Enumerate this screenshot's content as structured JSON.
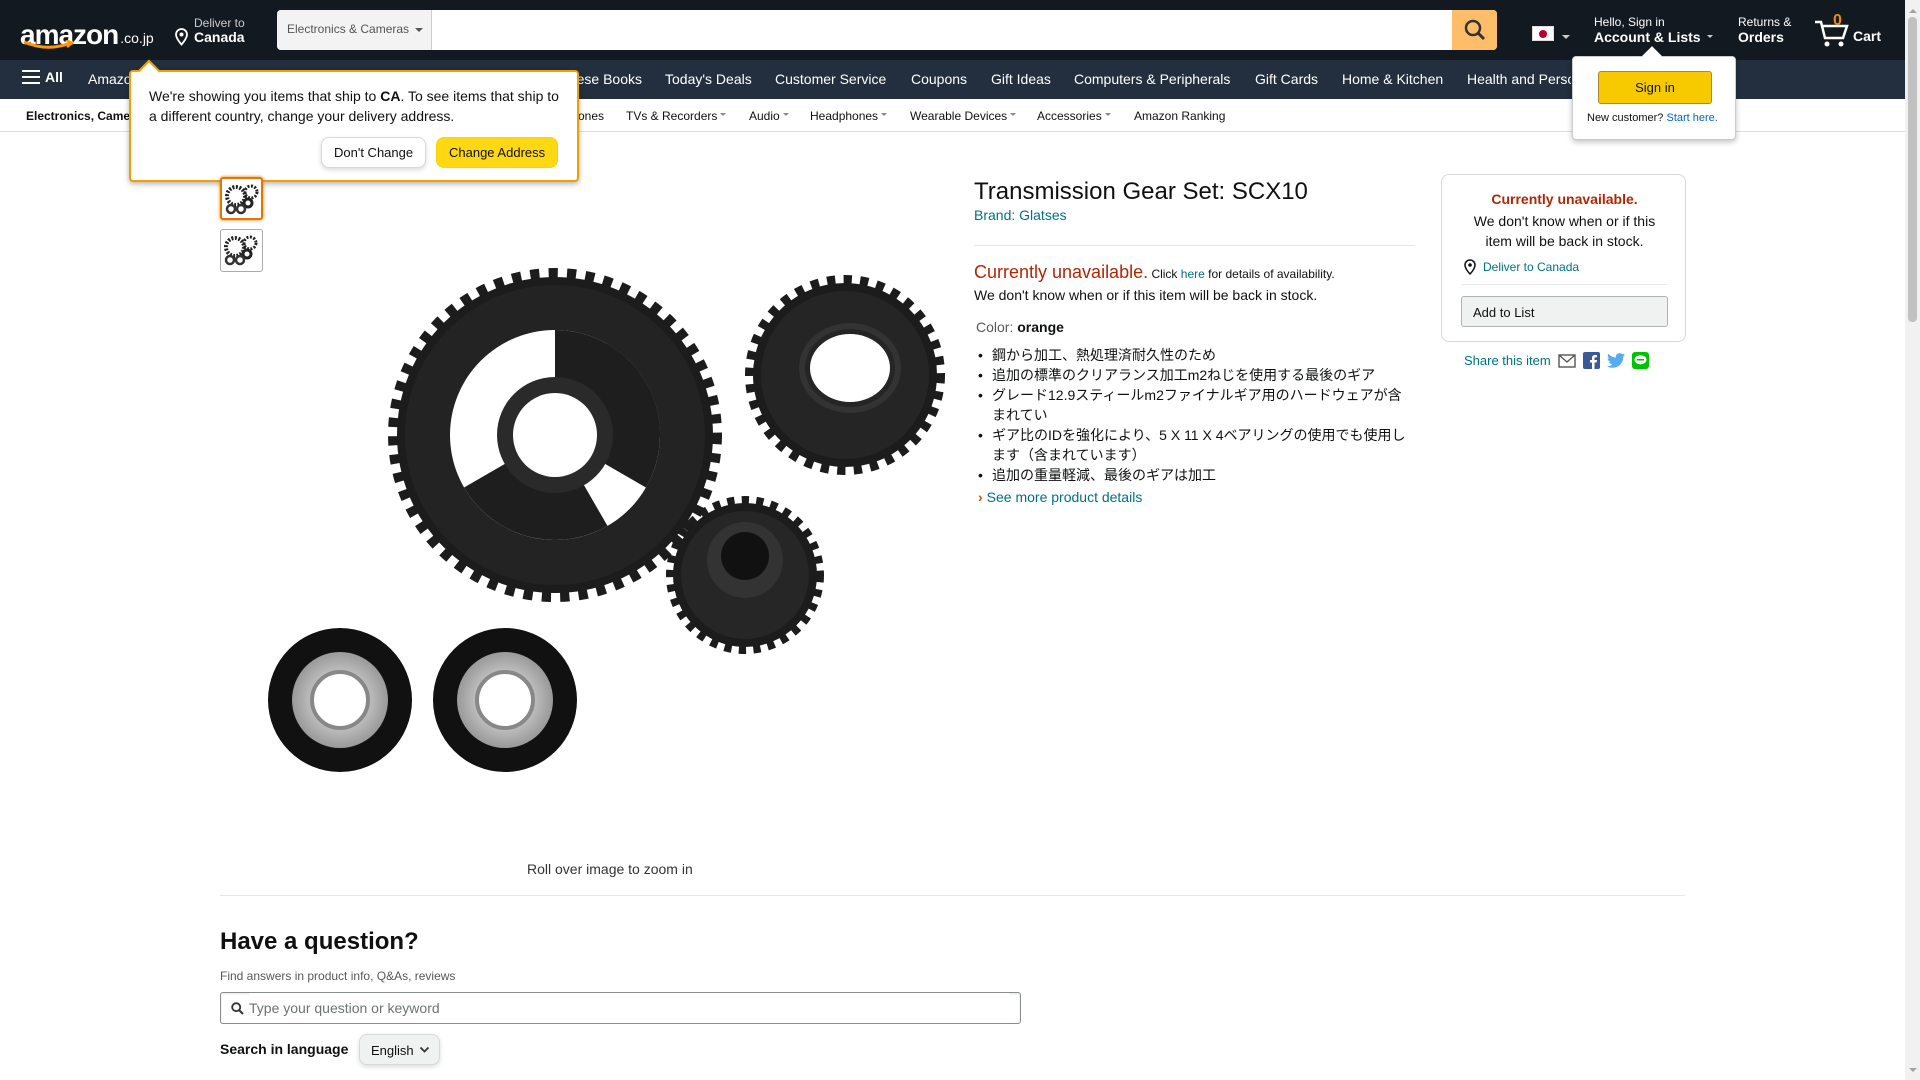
{
  "header": {
    "logo_word": "amazon",
    "logo_tld": ".co.jp",
    "deliver_line1": "Deliver to",
    "deliver_line2": "Canada",
    "search_category": "Electronics & Cameras",
    "search_value": "",
    "account_line1": "Hello, Sign in",
    "account_line2": "Account & Lists",
    "returns_line1": "Returns &",
    "returns_line2": "Orders",
    "cart_count": "0",
    "cart_label": "Cart"
  },
  "nav": {
    "all_label": "All",
    "items": [
      "Amazon",
      "Chinese Books",
      "Today's Deals",
      "Customer Service",
      "Coupons",
      "Gift Ideas",
      "Computers & Peripherals",
      "Gift Cards",
      "Home & Kitchen",
      "Health and Personal Care"
    ]
  },
  "subnav": {
    "items": [
      "Electronics, Cameras",
      "Phones",
      "TVs & Recorders",
      "Audio",
      "Headphones",
      "Wearable Devices",
      "Accessories",
      "Amazon Ranking"
    ]
  },
  "popover": {
    "text_before": "We're showing you items that ship to ",
    "country": "CA",
    "text_after": ". To see items that ship to a different country, change your delivery address.",
    "dont_change": "Don't Change",
    "change_address": "Change Address"
  },
  "signin_flyout": {
    "button": "Sign in",
    "new_customer": "New customer?",
    "start_here": "Start here."
  },
  "product": {
    "title": "Transmission Gear Set: SCX10",
    "brand": "Brand: Glatses",
    "unavailable": "Currently unavailable.",
    "click": "Click",
    "here": "here",
    "details_text": "for details of availability.",
    "stock_text": "We don't know when or if this item will be back in stock.",
    "color_label": "Color:",
    "color_value": "orange",
    "bullets": [
      "鋼から加工、熱処理済耐久性のため",
      "追加の標準のクリアランス加工m2ねじを使用する最後のギア",
      "グレード12.9スティールm2ファイナルギア用のハードウェアが含まれてい",
      "ギア比のIDを強化により、5 X 11 X 4ベアリングの使用でも使用します（含まれています）",
      "追加の重量軽減、最後のギアは加工"
    ],
    "see_more": "See more product details",
    "rollover": "Roll over image to zoom in"
  },
  "buybox": {
    "unavailable": "Currently unavailable.",
    "text": "We don't know when or if this item will be back in stock.",
    "deliver": "Deliver to Canada",
    "add_to_list": "Add to List",
    "share": "Share this item"
  },
  "question": {
    "heading": "Have a question?",
    "subtext": "Find answers in product info, Q&As, reviews",
    "placeholder": "Type your question or keyword",
    "lang_label": "Search in language",
    "lang_value": "English"
  },
  "colors": {
    "header_bg": "#131921",
    "nav_bg": "#232f3e",
    "accent_orange": "#febd69",
    "button_yellow": "#ffd814",
    "price_red": "#b12704",
    "link_teal": "#007185"
  }
}
